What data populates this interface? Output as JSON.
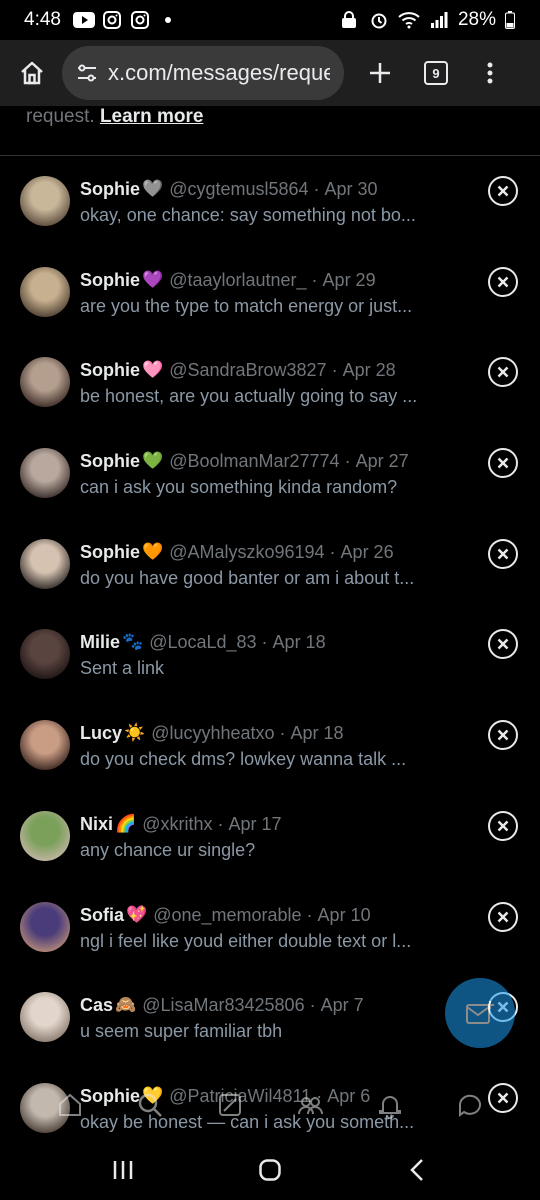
{
  "status_bar": {
    "time": "4:48",
    "battery": "28%"
  },
  "browser": {
    "url": "x.com/messages/reques",
    "tab_count": "9"
  },
  "top_note": {
    "text": "request.",
    "link": "Learn more"
  },
  "requests": [
    {
      "name": "Sophie",
      "emoji": "🩶",
      "handle": "@cygtemusl5864",
      "date": "Apr 30",
      "preview": "okay, one chance: say something not bo...",
      "avatar_colors": [
        "#c9b79a",
        "#5a4a3a"
      ]
    },
    {
      "name": "Sophie",
      "emoji": "💜",
      "handle": "@taaylorlautner_",
      "date": "Apr 29",
      "preview": "are you the type to match energy or just...",
      "avatar_colors": [
        "#c7b08f",
        "#4e3f31"
      ]
    },
    {
      "name": "Sophie",
      "emoji": "🩷",
      "handle": "@SandraBrow3827",
      "date": "Apr 28",
      "preview": "be honest, are you actually going to say ...",
      "avatar_colors": [
        "#b49e8e",
        "#3d2d27"
      ]
    },
    {
      "name": "Sophie",
      "emoji": "💚",
      "handle": "@BoolmanMar27774",
      "date": "Apr 27",
      "preview": "can i ask you something kinda random?",
      "avatar_colors": [
        "#b8a89e",
        "#3a2d2a"
      ]
    },
    {
      "name": "Sophie",
      "emoji": "🧡",
      "handle": "@AMalyszko96194",
      "date": "Apr 26",
      "preview": "do you have good banter or am i about t...",
      "avatar_colors": [
        "#d6c2b0",
        "#2f2a28"
      ]
    },
    {
      "name": "Milie",
      "emoji": "🐾",
      "handle": "@LocaLd_83",
      "date": "Apr 18",
      "preview": "Sent a link",
      "avatar_colors": [
        "#5a4440",
        "#1e1614"
      ]
    },
    {
      "name": "Lucy",
      "emoji": "☀️",
      "handle": "@lucyyhheatxo",
      "date": "Apr 18",
      "preview": "do you check dms? lowkey wanna talk ...",
      "avatar_colors": [
        "#c99c84",
        "#3a2620"
      ]
    },
    {
      "name": "Nixi",
      "emoji": "🌈",
      "handle": "@xkrithx",
      "date": "Apr 17",
      "preview": "any chance ur single?",
      "avatar_colors": [
        "#7aa05a",
        "#c4b5a5"
      ]
    },
    {
      "name": "Sofia",
      "emoji": "💖",
      "handle": "@one_memorable",
      "date": "Apr 10",
      "preview": "ngl i feel like youd either double text or l...",
      "avatar_colors": [
        "#4a3c7a",
        "#b68a78"
      ]
    },
    {
      "name": "Cas",
      "emoji": "🙈",
      "handle": "@LisaMar83425806",
      "date": "Apr 7",
      "preview": "u seem super familiar tbh",
      "avatar_colors": [
        "#e2d6cc",
        "#8a7a6e"
      ]
    },
    {
      "name": "Sophie",
      "emoji": "💛",
      "handle": "@PatriciaWil4811",
      "date": "Apr 6",
      "preview": "okay be honest — can i ask you someth...",
      "avatar_colors": [
        "#c2b8ae",
        "#4a3e36"
      ]
    }
  ],
  "colors": {
    "accent": "#1d9bf0",
    "background": "#000000",
    "secondary_text": "#71767b"
  },
  "icons": {
    "home": "home-icon",
    "site_settings": "tune-icon",
    "new_tab": "plus-icon",
    "menu": "more-vert-icon",
    "close": "close-circle-icon",
    "new_message": "new-message-icon"
  }
}
